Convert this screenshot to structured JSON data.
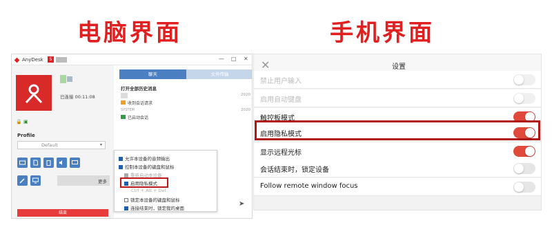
{
  "headings": {
    "desktop": "电脑界面",
    "mobile": "手机界面"
  },
  "desktop": {
    "app_name": "AnyDesk",
    "badge": "5",
    "window_controls": [
      "—",
      "□",
      "✕"
    ],
    "connection_status": "已连接 00:11:08",
    "profile_label": "Profile",
    "profile_value": "Default",
    "more_label": "更多",
    "end_label": "结束",
    "tabs": {
      "chat": "聊天",
      "file": "文件传输"
    },
    "chat_title": "打开全部历史消息",
    "messages": [
      {
        "sender": "",
        "time": "2020",
        "text": "收到会话请求"
      },
      {
        "sender": "SYSTEM",
        "time": "2020",
        "text": "已启动会话"
      }
    ],
    "menu_items": [
      {
        "label": "允许本设备的音频输出",
        "state": "checked"
      },
      {
        "label": "控制本设备的键盘和鼠标",
        "state": "checked"
      },
      {
        "label": "重新启动本设备",
        "state": "disabled"
      },
      {
        "label": "启用隐私模式",
        "state": "checked"
      },
      {
        "label": "Ctrl + Alt + Del",
        "state": "none"
      },
      {
        "label": "锁定本设备的键盘和鼠标",
        "state": "unchecked"
      },
      {
        "label": "连接结束时，锁定我的桌面",
        "state": "checked"
      }
    ],
    "accent_color": "#4a7fc1",
    "brand_color": "#e02020"
  },
  "mobile": {
    "title": "设置",
    "rows": [
      {
        "label": "禁止用户输入",
        "on": false,
        "dim": true
      },
      {
        "label": "启用自动键盘",
        "on": false,
        "dim": true
      },
      {
        "label": "触控板模式",
        "on": true,
        "dim": false
      },
      {
        "label": "启用隐私模式",
        "on": true,
        "dim": false
      },
      {
        "label": "显示远程光标",
        "on": true,
        "dim": false
      },
      {
        "label": "会话结束时，锁定设备",
        "on": false,
        "dim": false
      },
      {
        "label": "Follow remote window focus",
        "on": false,
        "dim": false
      }
    ],
    "toggle_on_color": "#e04a3c"
  }
}
